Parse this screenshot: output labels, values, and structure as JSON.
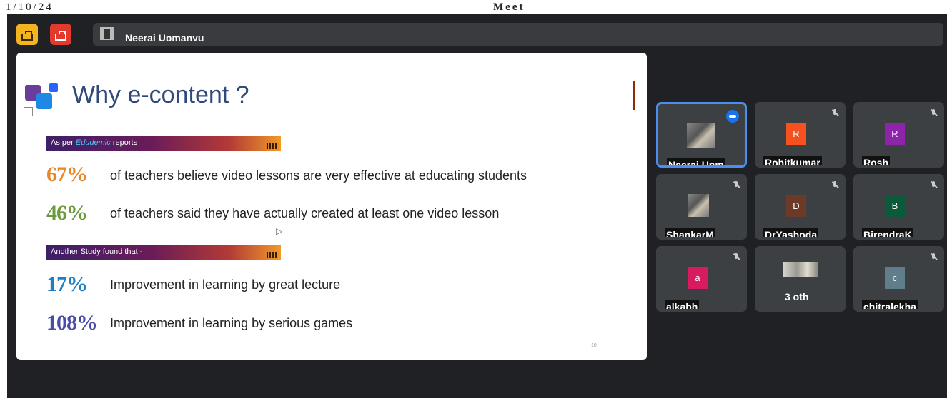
{
  "page_header": {
    "left_text": "1/10/24",
    "center_text": "Meet"
  },
  "toolbar": {
    "presenter_name": "Neeraj Upmanyu"
  },
  "slide": {
    "title": "Why e-content ?",
    "banner1": {
      "prefix": "As per ",
      "emphasis": "Edudemic",
      "suffix": " reports"
    },
    "banner2": {
      "text": "Another Study found that -"
    },
    "stats": [
      {
        "value": "67%",
        "text": "of teachers believe video lessons are very effective at educating students"
      },
      {
        "value": "46%",
        "text": "of teachers said they have actually created at least one video lesson"
      },
      {
        "value": "17%",
        "text": "Improvement in learning by great lecture"
      },
      {
        "value": "108%",
        "text": "Improvement in learning by serious games"
      }
    ],
    "page_number": "10"
  },
  "participants": [
    {
      "name": "Neeraj Upm",
      "avatar": "",
      "state": "speaking"
    },
    {
      "name": "Rohitkumar",
      "avatar": "R",
      "color": "#f4511e",
      "state": "muted"
    },
    {
      "name": "Rosh",
      "avatar": "R",
      "color": "#8e24aa",
      "state": "muted"
    },
    {
      "name": "ShankarM",
      "avatar": "",
      "state": "muted"
    },
    {
      "name": "DrYashoda",
      "avatar": "D",
      "color": "#6d3a28",
      "state": "muted"
    },
    {
      "name": "BirendraK",
      "avatar": "B",
      "color": "#0b5a3a",
      "state": "muted"
    },
    {
      "name": "alkabh",
      "avatar": "a",
      "color": "#d81b60",
      "state": "muted"
    },
    {
      "name": "3 oth",
      "avatar": "",
      "state": "others"
    },
    {
      "name": "chitralekha",
      "avatar": "c",
      "color": "#607d8b",
      "state": "muted"
    }
  ],
  "colors": {
    "background": "#202124",
    "tile": "#3c4043",
    "active_border": "#4a8ef0",
    "title": "#2f4a7a"
  }
}
